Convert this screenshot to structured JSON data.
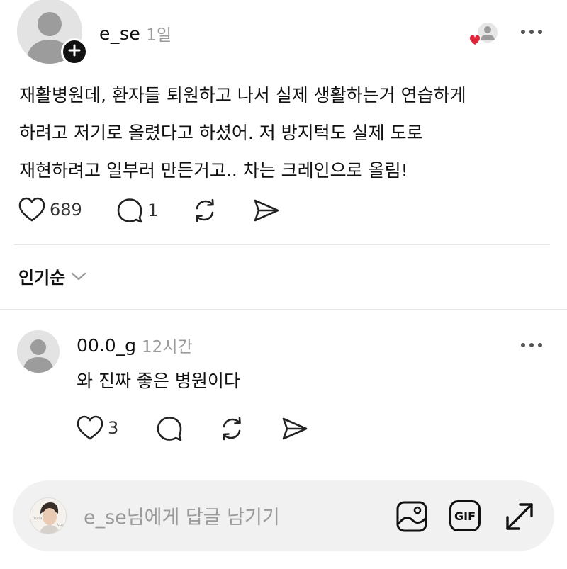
{
  "post": {
    "username": "e_se",
    "time": "1일",
    "body_lines": [
      "재활병원데, 환자들 퇴원하고 나서 실제 생활하는거 연습하게",
      "하려고 저기로 올렸다고 하셨어. 저 방지턱도 실제 도로",
      "재현하려고 일부러 만든거고.. 차는 크레인으로 올림!"
    ],
    "likes": "689",
    "comments": "1"
  },
  "sort": {
    "label": "인기순"
  },
  "comment": {
    "username": "00.0_g",
    "time": "12시간",
    "text": "와 진짜 좋은 병원이다",
    "likes": "3"
  },
  "reply": {
    "placeholder": "e_se님에게 답글 남기기"
  },
  "icons": {
    "follow": "plus-icon",
    "liked_by_author": "heart-avatar-icon",
    "more": "more-dots-icon",
    "like": "heart-icon",
    "comment": "comment-bubble-icon",
    "repost": "repost-icon",
    "share": "send-icon",
    "chevron": "chevron-down-icon",
    "image": "image-icon",
    "gif": "gif-icon",
    "expand": "expand-icon"
  },
  "colors": {
    "heart_red": "#e0253a",
    "muted_text": "#9a9a9a",
    "reply_bar_bg": "#f1f1f1"
  }
}
